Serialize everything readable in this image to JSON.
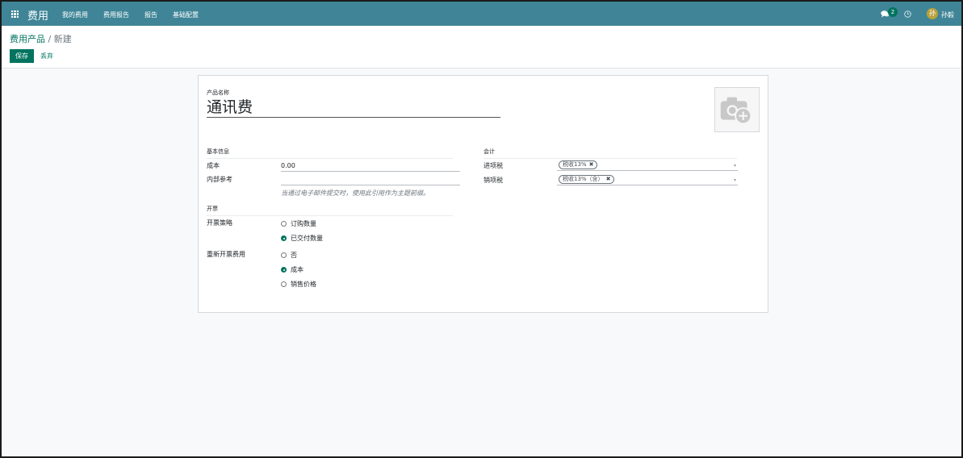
{
  "navbar": {
    "app_title": "费用",
    "menu": [
      "我的费用",
      "费用报告",
      "报告",
      "基础配置"
    ],
    "chat_count": "2",
    "user_avatar": "孙",
    "user_name": "孙毅"
  },
  "control_panel": {
    "breadcrumb_parent": "费用产品",
    "breadcrumb_sep": " / ",
    "breadcrumb_current": "新建",
    "save_label": "保存",
    "discard_label": "丢弃"
  },
  "form": {
    "name_label": "产品名称",
    "name_value": "通讯费",
    "section_basic": "基本信息",
    "cost_label": "成本",
    "cost_value": "0.00",
    "internal_ref_label": "内部参考",
    "internal_ref_value": "",
    "internal_ref_help": "当通过电子邮件提交时，使用此引用作为主题前缀。",
    "section_invoicing": "开票",
    "invoice_policy_label": "开票策略",
    "invoice_policy_options": [
      "订购数量",
      "已交付数量"
    ],
    "reinvoice_label": "重新开票费用",
    "reinvoice_options": [
      "否",
      "成本",
      "销售价格"
    ],
    "section_accounting": "会计",
    "purchase_tax_label": "进项税",
    "purchase_tax_tag": "税收13%",
    "sale_tax_label": "销项税",
    "sale_tax_tag": "税收13%（含）"
  },
  "colors": {
    "navbar": "#3f8597",
    "primary": "#00745f",
    "avatar": "#b8a13b"
  },
  "icons": {
    "apps": "apps-grid-icon",
    "chat": "chat-icon",
    "activity": "clock-icon",
    "image_placeholder": "camera-plus-icon",
    "tag_remove": "close-icon",
    "dropdown": "caret-down-icon"
  }
}
